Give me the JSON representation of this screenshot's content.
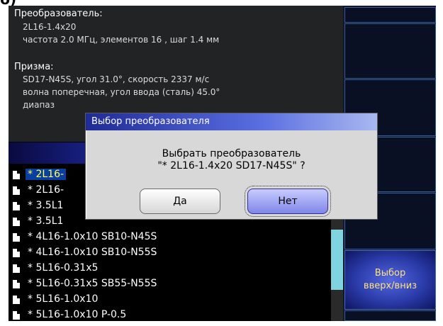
{
  "caption": "б)",
  "info": {
    "transducer_heading": "Преобразователь:",
    "transducer_name": "2L16-1.4x20",
    "transducer_params": "частота 2.0 МГц, элементов 16 , шаг 1.4 мм",
    "prism_heading": "Призма:",
    "prism_line1": "SD17-N45S,  угол 31.0°, скорость 2337 м/с",
    "prism_line2": "волна поперечная, угол ввода (сталь) 45.0°",
    "prism_line3": "диапаз"
  },
  "list": {
    "items": [
      {
        "label": "* 2L16-"
      },
      {
        "label": "* 2L16-"
      },
      {
        "label": "* 3.5L1"
      },
      {
        "label": "* 3.5L1"
      },
      {
        "label": "* 4L16-1.0x10 SB10-N45S"
      },
      {
        "label": "* 4L16-1.0x10 SB10-N55S"
      },
      {
        "label": "* 5L16-0.31x5"
      },
      {
        "label": "* 5L16-0.31x5 SB55-N55S"
      },
      {
        "label": "* 5L16-1.0x10"
      },
      {
        "label": "* 5L16-1.0x10 P-0.5"
      }
    ],
    "selected_index": 0,
    "scroll_position": 0.45
  },
  "sidebar": {
    "button_line1": "Выбор",
    "button_line2": "вверх/вниз"
  },
  "dialog": {
    "title": "Выбор преобразователя",
    "message_line1": "Выбрать преобразователь",
    "message_line2": "\"* 2L16-1.4x20 SD17-N45S\" ?",
    "yes_label": "Да",
    "no_label": "Нет"
  },
  "colors": {
    "selected_text": "#ffff55",
    "selected_bg": "#0a3fa0",
    "sidebar_button_text": "#ffe27a",
    "scroll_thumb": "#7fd4e0"
  }
}
